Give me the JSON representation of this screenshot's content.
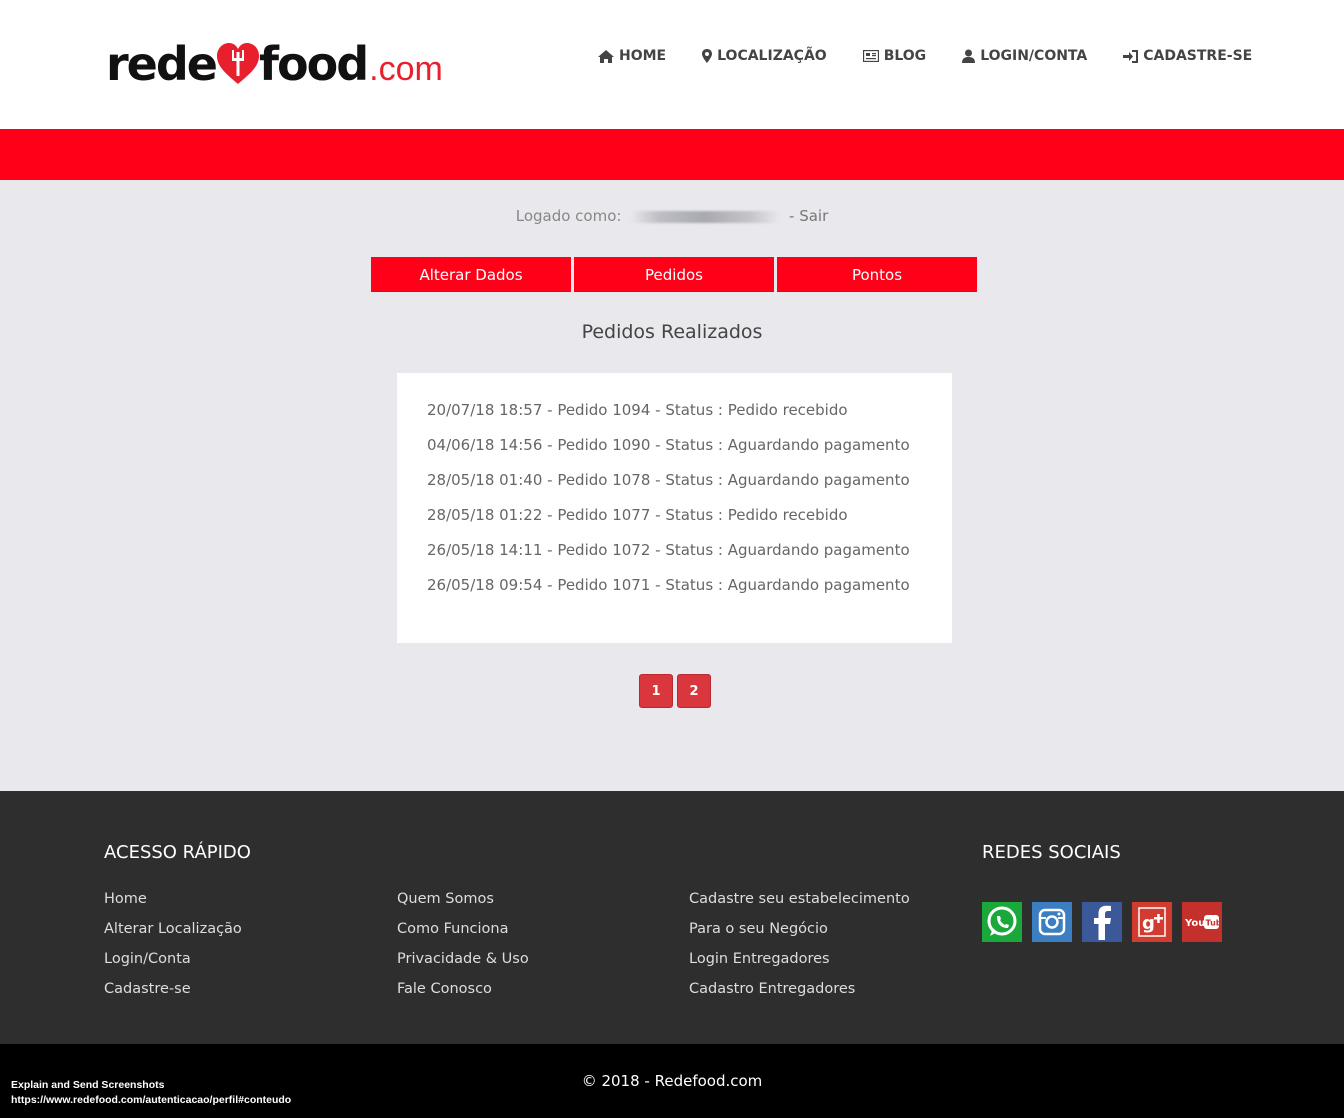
{
  "header": {
    "logo": {
      "part1": "rede",
      "part2": "food",
      "suffix": ".com"
    },
    "nav": [
      {
        "label": "HOME",
        "icon": "home-icon"
      },
      {
        "label": "LOCALIZAÇÃO",
        "icon": "map-marker-icon"
      },
      {
        "label": "BLOG",
        "icon": "newspaper-icon"
      },
      {
        "label": "LOGIN/CONTA",
        "icon": "user-icon"
      },
      {
        "label": "CADASTRE-SE",
        "icon": "sign-in-icon"
      }
    ]
  },
  "account": {
    "logged_label": "Logado como:",
    "logout_label": "- Sair",
    "tabs": [
      "Alterar Dados",
      "Pedidos",
      "Pontos"
    ]
  },
  "orders": {
    "title": "Pedidos Realizados",
    "items": [
      "20/07/18 18:57 - Pedido 1094 - Status : Pedido recebido",
      "04/06/18 14:56 - Pedido 1090 - Status : Aguardando pagamento",
      "28/05/18 01:40 - Pedido 1078 - Status : Aguardando pagamento",
      "28/05/18 01:22 - Pedido 1077 - Status : Pedido recebido",
      "26/05/18 14:11 - Pedido 1072 - Status : Aguardando pagamento",
      "26/05/18 09:54 - Pedido 1071 - Status : Aguardando pagamento"
    ],
    "pages": [
      "1",
      "2"
    ]
  },
  "footer": {
    "quick_title": "ACESSO RÁPIDO",
    "social_title": "REDES SOCIAIS",
    "col1": [
      "Home",
      "Alterar Localização",
      "Login/Conta",
      "Cadastre-se"
    ],
    "col2": [
      "Quem Somos",
      "Como Funciona",
      "Privacidade & Uso",
      "Fale Conosco"
    ],
    "col3": [
      "Cadastre seu estabelecimento",
      "Para o seu Negócio",
      "Login Entregadores",
      "Cadastro Entregadores"
    ],
    "social": [
      {
        "name": "whatsapp-icon",
        "color": "#1aa83a"
      },
      {
        "name": "instagram-icon",
        "color": "#3b7ec2"
      },
      {
        "name": "facebook-icon",
        "color": "#3b5998"
      },
      {
        "name": "google-plus-icon",
        "color": "#d23b2f"
      },
      {
        "name": "youtube-icon",
        "color": "#c4302b"
      }
    ],
    "copyright": "© 2018 - Redefood.com"
  },
  "overlay": {
    "line1": "Explain and Send Screenshots",
    "line2": "https://www.redefood.com/autenticacao/perfil#conteudo"
  },
  "colors": {
    "brand_red": "#ff0018",
    "page_bg": "#e8e8ed",
    "footer_bg": "#2e2e2e"
  }
}
